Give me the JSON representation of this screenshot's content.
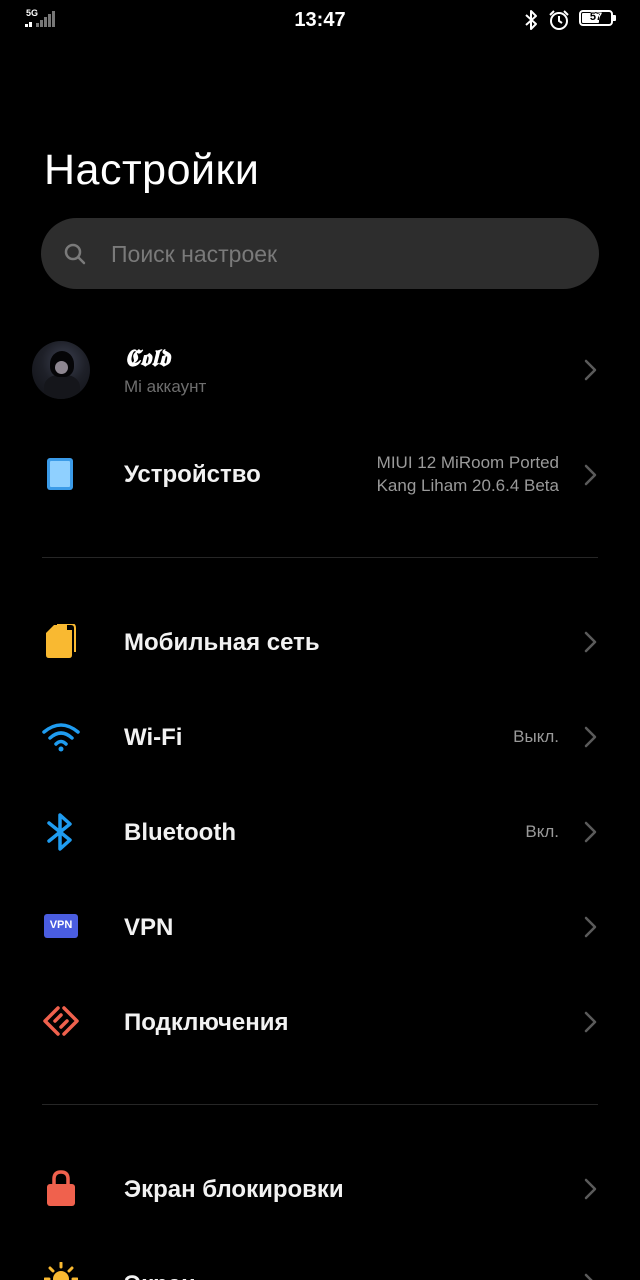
{
  "status_bar": {
    "network": "5G",
    "time": "13:47",
    "battery": "57",
    "icons": [
      "signal-icon",
      "bluetooth-icon",
      "alarm-icon",
      "battery-icon"
    ]
  },
  "title": "Настройки",
  "search": {
    "placeholder": "Поиск настроек"
  },
  "account": {
    "name": "𝕮𝖔𝖑𝖉",
    "subtitle": "Mi аккаунт"
  },
  "items": [
    {
      "label": "Устройство",
      "value_line1": "MIUI 12 MiRoom  Ported",
      "value_line2": "Kang Liham 20.6.4 Beta",
      "icon": "tablet-icon"
    },
    {
      "label": "Мобильная сеть",
      "value": "",
      "icon": "sim-card-icon"
    },
    {
      "label": "Wi-Fi",
      "value": "Выкл.",
      "icon": "wifi-icon"
    },
    {
      "label": "Bluetooth",
      "value": "Вкл.",
      "icon": "bluetooth-icon"
    },
    {
      "label": "VPN",
      "value": "",
      "icon": "vpn-icon",
      "badge": "VPN"
    },
    {
      "label": "Подключения",
      "value": "",
      "icon": "connections-icon"
    },
    {
      "label": "Экран блокировки",
      "value": "",
      "icon": "lock-icon"
    },
    {
      "label": "Экран",
      "value": "",
      "icon": "brightness-icon"
    }
  ],
  "colors": {
    "background": "#000000",
    "search_bg": "#2d2d2d",
    "tablet": "#3b9be8",
    "sim": "#f9b931",
    "wifi": "#1f9cf0",
    "bluetooth": "#1f9cf0",
    "vpn": "#4a5de0",
    "connections": "#f0614d",
    "lock": "#f0614d",
    "brightness": "#f9b931"
  }
}
